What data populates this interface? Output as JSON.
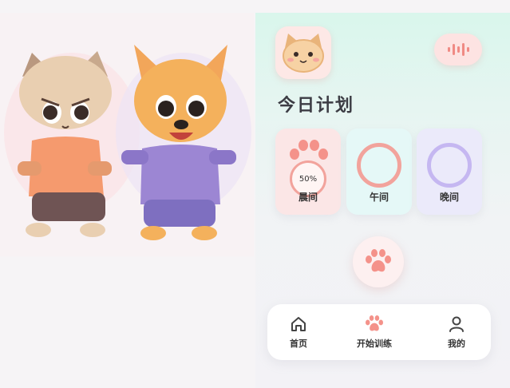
{
  "header": {
    "title": "今日计划",
    "avatar_icon": "cat-face-icon",
    "voice_icon": "sound-wave-icon"
  },
  "plan_cards": [
    {
      "label": "晨间",
      "progress_text": "50%",
      "progress": 0.5,
      "color": "#f2a39c"
    },
    {
      "label": "午间",
      "color": "#f2a39c"
    },
    {
      "label": "晚间",
      "color": "#c5b7f1"
    }
  ],
  "fab": {
    "icon": "paw-icon"
  },
  "nav": {
    "items": [
      {
        "label": "首页",
        "icon": "home-icon"
      },
      {
        "label": "开始训练",
        "icon": "paw-icon"
      },
      {
        "label": "我的",
        "icon": "user-icon"
      }
    ]
  },
  "colors": {
    "accent": "#f4928a",
    "lavender": "#c5b7f1",
    "mint": "#d9f6ec"
  }
}
